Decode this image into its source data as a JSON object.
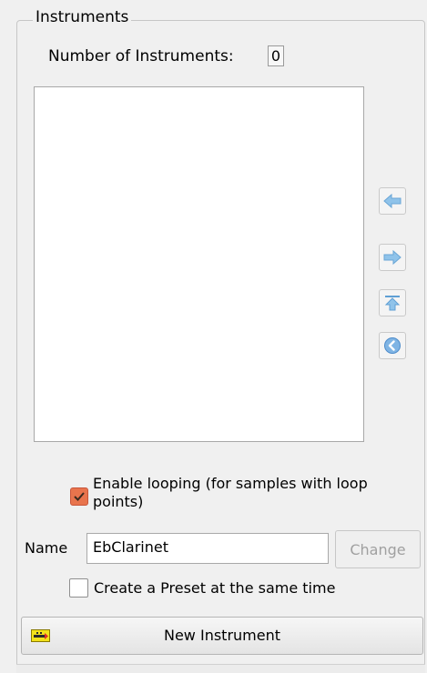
{
  "group": {
    "title": "Instruments"
  },
  "count": {
    "label": "Number of Instruments:",
    "value": "0"
  },
  "instruments_list": {
    "items": []
  },
  "side_buttons": [
    {
      "icon": "arrow-left-icon"
    },
    {
      "icon": "arrow-right-icon"
    },
    {
      "icon": "move-to-top-icon"
    },
    {
      "icon": "back-circle-icon"
    }
  ],
  "looping": {
    "label": "Enable looping (for samples with loop points)",
    "checked": true,
    "color": "#e8744d"
  },
  "name": {
    "label": "Name",
    "value": "EbClarinet",
    "change_label": "Change"
  },
  "preset": {
    "label": "Create a Preset at the same time",
    "checked": false
  },
  "new_instrument": {
    "label": "New Instrument",
    "icon": "instrument-icon"
  }
}
